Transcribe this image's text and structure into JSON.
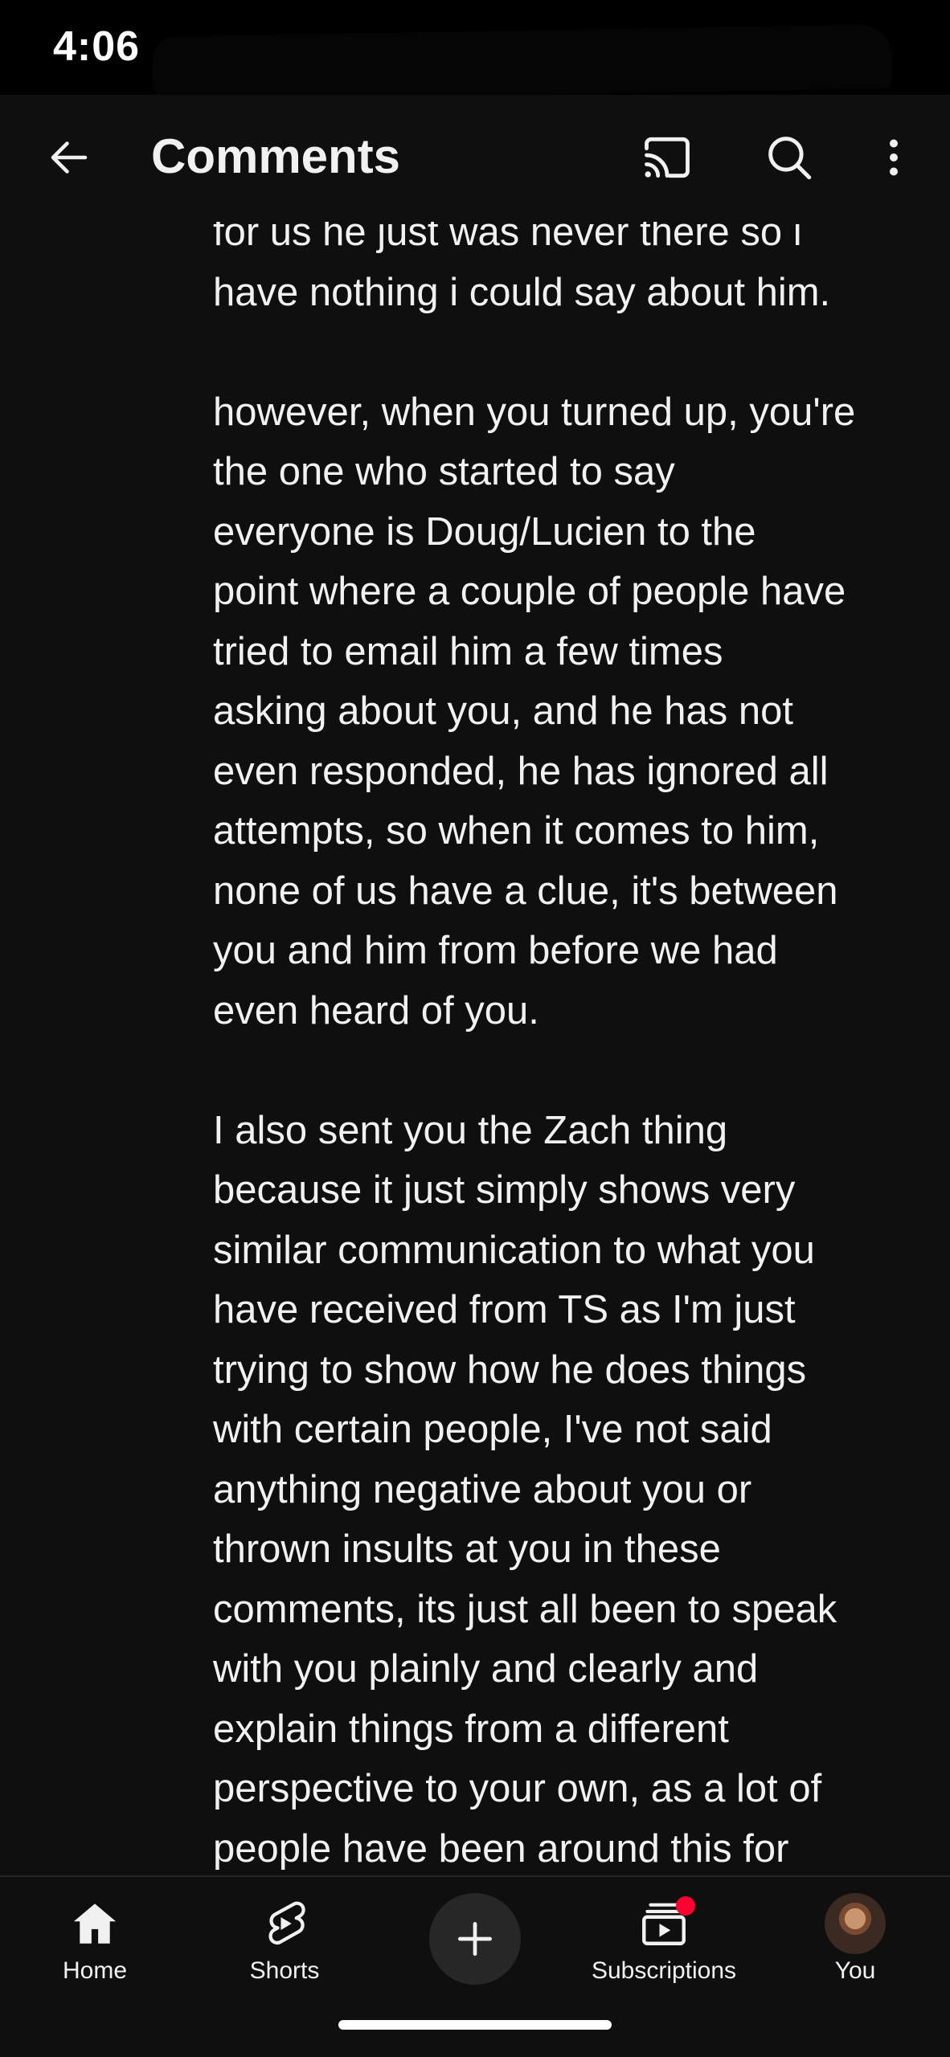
{
  "status_bar": {
    "time": "4:06"
  },
  "app_bar": {
    "title": "Comments",
    "back_icon": "arrow-back-icon",
    "cast_icon": "cast-icon",
    "search_icon": "search-icon",
    "more_icon": "more-vert-icon"
  },
  "comment": {
    "paragraphs": [
      {
        "lines": [
          "for us he just was never there so i",
          "have nothing i could say about him."
        ]
      },
      {
        "lines": [
          "however, when you turned up, you're",
          "the one who started to say",
          "everyone is Doug/Lucien to the",
          "point where a couple of people have",
          "tried to email him a few times",
          "asking about you, and he has not",
          "even responded, he has ignored all",
          "attempts, so when it comes to him,",
          "none of us have a clue, it's between",
          "you and him from before we had",
          "even heard of you."
        ]
      },
      {
        "lines": [
          "I also sent you the Zach thing",
          "because it just simply shows very",
          "similar communication to what you",
          "have received from TS as I'm just",
          "trying to show how he does things",
          "with certain people, I've not said",
          "anything negative about you or",
          "thrown insults at you in these",
          "comments, its just all been to speak",
          "with you plainly and clearly and",
          "explain things from a different",
          "perspective to your own, as a lot of",
          "people have been around this for"
        ]
      }
    ]
  },
  "bottom_nav": {
    "items": [
      {
        "label": "Home",
        "icon": "home-icon"
      },
      {
        "label": "Shorts",
        "icon": "shorts-icon"
      },
      {
        "label": "",
        "icon": "create-plus-icon"
      },
      {
        "label": "Subscriptions",
        "icon": "subscriptions-icon",
        "has_notification": true
      },
      {
        "label": "You",
        "icon": "avatar"
      }
    ]
  },
  "colors": {
    "background": "#0f0f0f",
    "text": "#f1f1f1",
    "notification": "#ff0033",
    "create_button_bg": "#272727"
  }
}
